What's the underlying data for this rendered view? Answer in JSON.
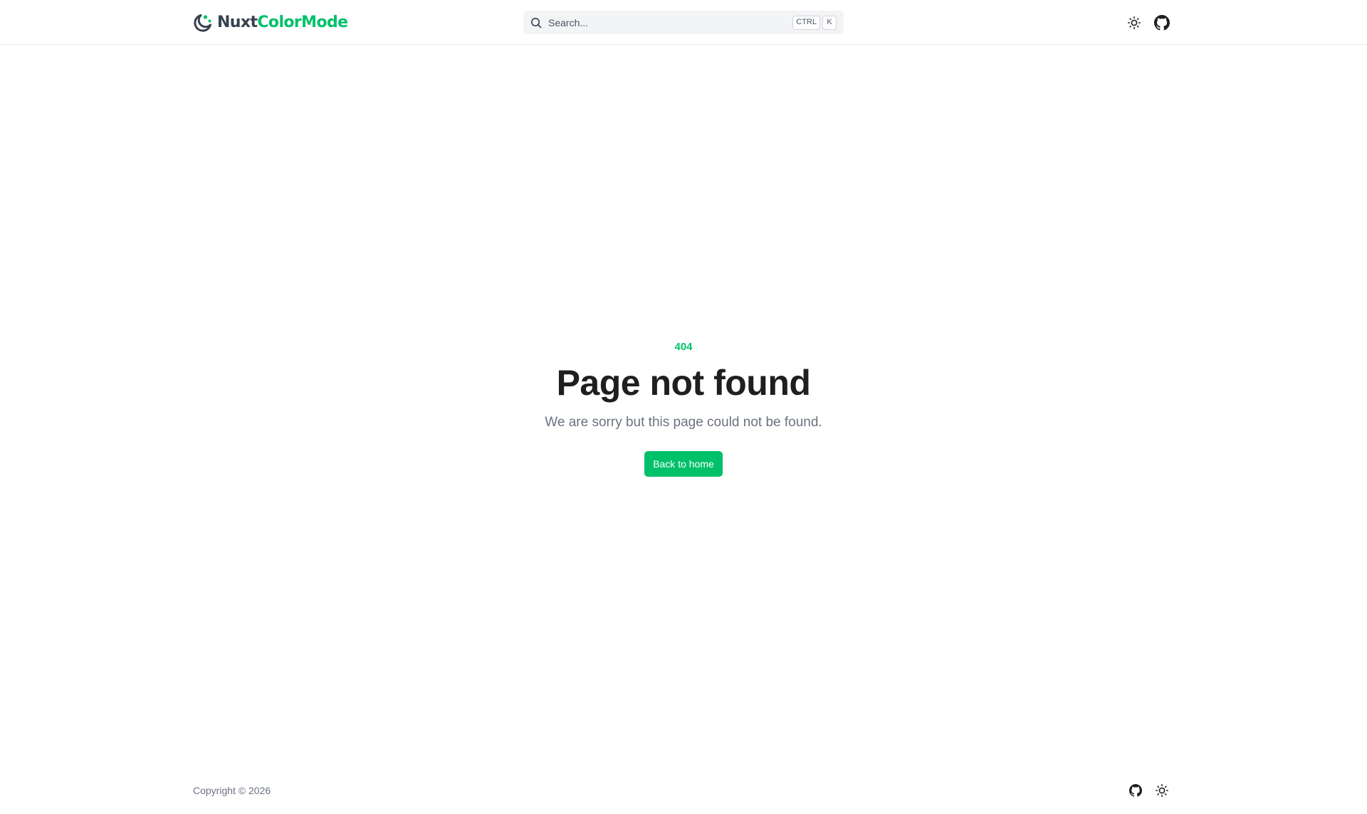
{
  "header": {
    "logo": {
      "icon": "moon-logo-icon",
      "part1": "Nuxt",
      "part2": "ColorMode"
    },
    "search": {
      "placeholder": "Search...",
      "shortcut_keys": [
        "CTRL",
        "K"
      ],
      "icon": "search-icon"
    },
    "actions": [
      {
        "name": "color-mode-toggle",
        "icon": "sun-icon"
      },
      {
        "name": "github-link",
        "icon": "github-icon"
      }
    ]
  },
  "error": {
    "code": "404",
    "title": "Page not found",
    "message": "We are sorry but this page could not be found.",
    "button_label": "Back to home"
  },
  "footer": {
    "copyright": "Copyright © 2026",
    "actions": [
      {
        "name": "github-link",
        "icon": "github-icon"
      },
      {
        "name": "color-mode-toggle",
        "icon": "sun-icon"
      }
    ]
  },
  "colors": {
    "primary": "#00c16a",
    "text": "#1f1f21",
    "muted": "#6b7280",
    "border": "#e5e7eb",
    "search_bg": "#f3f4f6"
  }
}
